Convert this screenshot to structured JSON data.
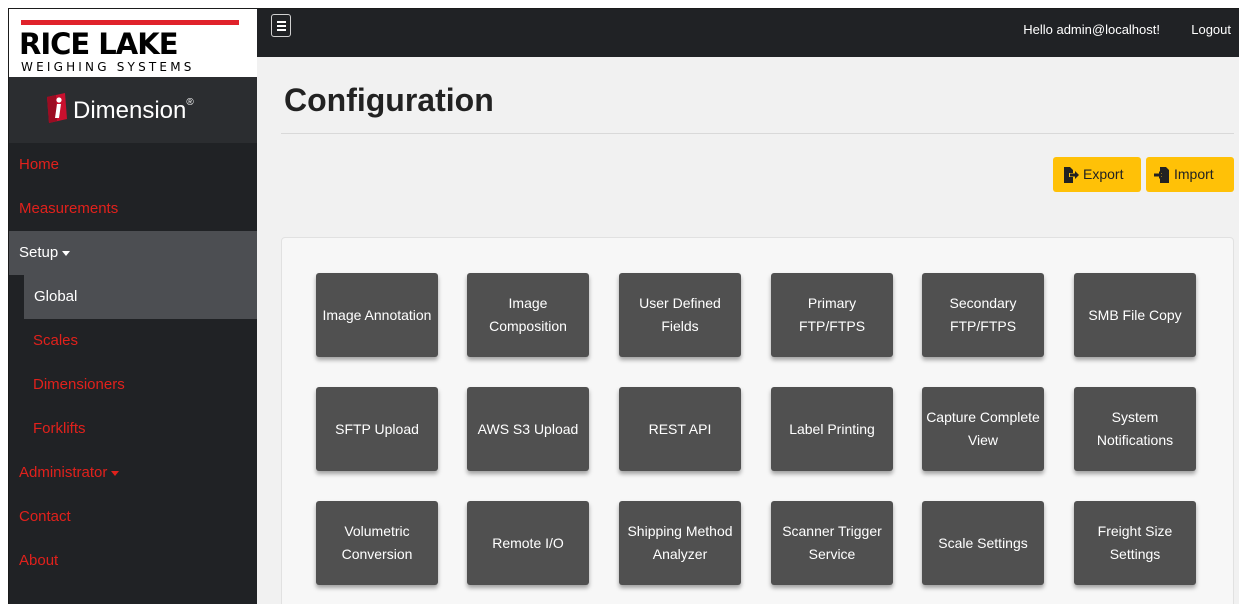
{
  "brand": {
    "company": "RICE LAKE",
    "tagline": "WEIGHING SYSTEMS",
    "product": "Dimension",
    "product_mark": "®",
    "logo_icon": "i-dimension-icon"
  },
  "nav": {
    "items": [
      {
        "label": "Home"
      },
      {
        "label": "Measurements"
      },
      {
        "label": "Setup"
      },
      {
        "label": "Global"
      },
      {
        "label": "Scales"
      },
      {
        "label": "Dimensioners"
      },
      {
        "label": "Forklifts"
      },
      {
        "label": "Administrator"
      },
      {
        "label": "Contact"
      },
      {
        "label": "About"
      }
    ]
  },
  "topbar": {
    "menu_icon": "hamburger-icon",
    "greeting": "Hello admin@localhost!",
    "logout": "Logout"
  },
  "page": {
    "title": "Configuration"
  },
  "actions": {
    "export": "Export",
    "import": "Import",
    "accent": "#ffc107"
  },
  "tiles": [
    "Image Annotation",
    "Image Composition",
    "User Defined Fields",
    "Primary FTP/FTPS",
    "Secondary FTP/FTPS",
    "SMB File Copy",
    "SFTP Upload",
    "AWS S3 Upload",
    "REST API",
    "Label Printing",
    "Capture Complete View",
    "System Notifications",
    "Volumetric Conversion",
    "Remote I/O",
    "Shipping Method Analyzer",
    "Scanner Trigger Service",
    "Scale Settings",
    "Freight Size Settings"
  ],
  "colors": {
    "sidebar_bg": "#202225",
    "nav_link": "#e0211c",
    "tile_bg": "#505050",
    "brand_red": "#e0222b"
  }
}
